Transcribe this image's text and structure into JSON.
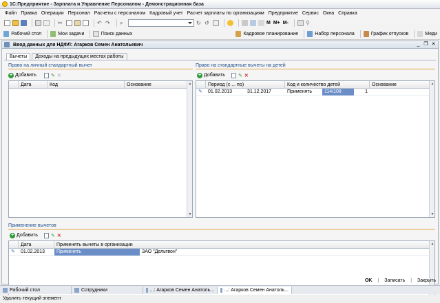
{
  "window": {
    "title": "1С:Предприятие - Зарплата и Управление Персоналом - Демонстрационная база"
  },
  "menu": [
    "Файл",
    "Правка",
    "Операции",
    "Персонал",
    "Расчеты с персоналом",
    "Кадровый учет",
    "Расчет зарплаты по организациям",
    "Предприятие",
    "Сервис",
    "Окна",
    "Справка"
  ],
  "toolbar1": {
    "m_labels": [
      "M",
      "M+",
      "M-"
    ]
  },
  "toolbar2": {
    "items": [
      "Рабочий стол",
      "Мои задачи",
      "Поиск данных",
      "Кадровое планирование",
      "Набор персонала",
      "График отпусков",
      "Меди"
    ]
  },
  "form": {
    "title": "Ввод данных для НДФЛ: Агарков Семен Анатольевич",
    "tabs": [
      "Вычеты",
      "Доходы на предыдущих местах работы"
    ],
    "left_panel": {
      "title": "Право на личный стандартный вычет",
      "add_label": "Добавить",
      "columns": [
        "Дата",
        "Код",
        "Основание"
      ]
    },
    "right_panel": {
      "title": "Право на стандартные вычеты на детей",
      "add_label": "Добавить",
      "columns": [
        "Период (с ... по)",
        "Код и количество детей",
        "Основание"
      ],
      "rows": [
        {
          "from": "01.02.2013",
          "to": "31.12.2017",
          "action": "Применять",
          "code": "114/108",
          "count": "1"
        }
      ]
    },
    "apply_panel": {
      "title": "Применение вычетов",
      "add_label": "Добавить",
      "columns": [
        "Дата",
        "Применять вычеты в организации"
      ],
      "rows": [
        {
          "date": "01.02.2013",
          "action": "Применять",
          "org": "ЗАО \"Дельтвон\""
        }
      ]
    },
    "buttons": {
      "ok": "OK",
      "save": "Записать",
      "close": "Закрыть"
    }
  },
  "taskbar": [
    "Рабочий стол",
    "Сотрудники",
    "...: Агарков Семен Анатоль...",
    "...: Агарков Семен Анатоль..."
  ],
  "status": "Удалить текущий элемент"
}
